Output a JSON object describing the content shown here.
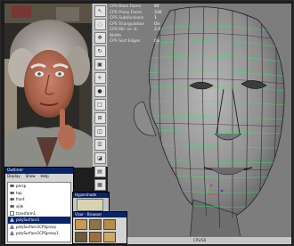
{
  "viewport": {
    "stats": [
      {
        "label": "CPS Base Faces",
        "value": "84"
      },
      {
        "label": "CPS Proxy Faces",
        "value": "336"
      },
      {
        "label": "CPS Subdivisions",
        "value": "1"
      },
      {
        "label": "CPS Triangulation",
        "value": "On"
      },
      {
        "label": "CPS Mir- or- & Width",
        "value": "2.0"
      },
      {
        "label": "CPS Sort Edges",
        "value": "On"
      }
    ],
    "status_text": "CPS/SB"
  },
  "toolstrip": {
    "tools": [
      "select-tool-icon",
      "lasso-tool-icon",
      "move-tool-icon",
      "rotate-tool-icon",
      "scale-tool-icon",
      "manipulator-icon",
      "last-tool-icon",
      "layout-single-icon",
      "layout-four-icon",
      "layout-side-icon",
      "layout-stack-icon",
      "layout-persp-icon",
      "layout-outliner-icon",
      "layout-graph-icon"
    ]
  },
  "outliner": {
    "title": "Outliner",
    "menus": [
      "Display",
      "Show",
      "Help"
    ],
    "items": [
      {
        "label": "persp",
        "selected": false
      },
      {
        "label": "top",
        "selected": false
      },
      {
        "label": "front",
        "selected": false
      },
      {
        "label": "side",
        "selected": false
      },
      {
        "label": "transform1",
        "selected": false
      },
      {
        "label": "polySurface1",
        "selected": true
      },
      {
        "label": "polySurface1CPSproxy",
        "selected": false
      },
      {
        "label": "polySurface1CPSproxy1",
        "selected": false
      }
    ]
  },
  "hypershade": {
    "title": "Hypershade"
  },
  "browser": {
    "title": "Visor - Browser"
  },
  "colors": {
    "selection": "#0a246a",
    "viewport_bg": "#7d7d7d",
    "wire": "#2ee86a",
    "face": "#a9a9a9"
  }
}
